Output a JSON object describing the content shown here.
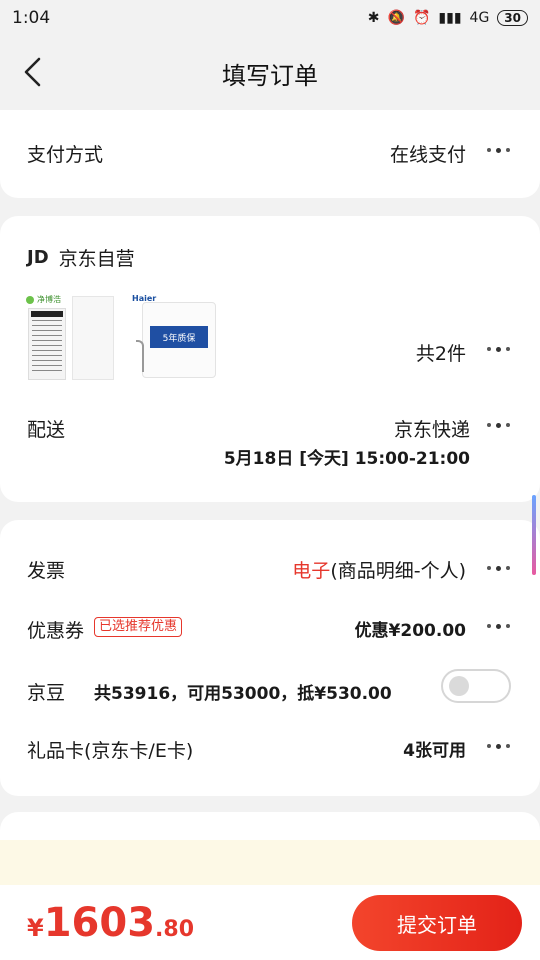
{
  "status_bar": {
    "time": "1:04",
    "network": "4G",
    "battery": "30"
  },
  "header": {
    "title": "填写订单"
  },
  "payment": {
    "label": "支付方式",
    "value": "在线支付"
  },
  "shop": {
    "logo": "JD",
    "name": "京东自营"
  },
  "products": {
    "count_text": "共2件",
    "item1_brand": "净博浩",
    "item2_badge": "5年质保"
  },
  "delivery": {
    "label": "配送",
    "carrier": "京东快递",
    "time": "5月18日 [今天] 15:00-21:00"
  },
  "invoice": {
    "label": "发票",
    "type_highlight": "电子",
    "type_detail": "(商品明细-个人)"
  },
  "coupon": {
    "label": "优惠券",
    "tag": "已选推荐优惠",
    "value": "优惠¥200.00"
  },
  "jingdou": {
    "label": "京豆",
    "detail": "共53916，可用53000，抵¥530.00",
    "enabled": false
  },
  "gift_card": {
    "label": "礼品卡(京东卡/E卡)",
    "value": "4张可用"
  },
  "footer": {
    "currency": "¥",
    "price_int": "1603",
    "price_dec": ".80",
    "submit_label": "提交订单"
  },
  "colors": {
    "accent": "#e6372c",
    "background": "#f2f2f2"
  }
}
